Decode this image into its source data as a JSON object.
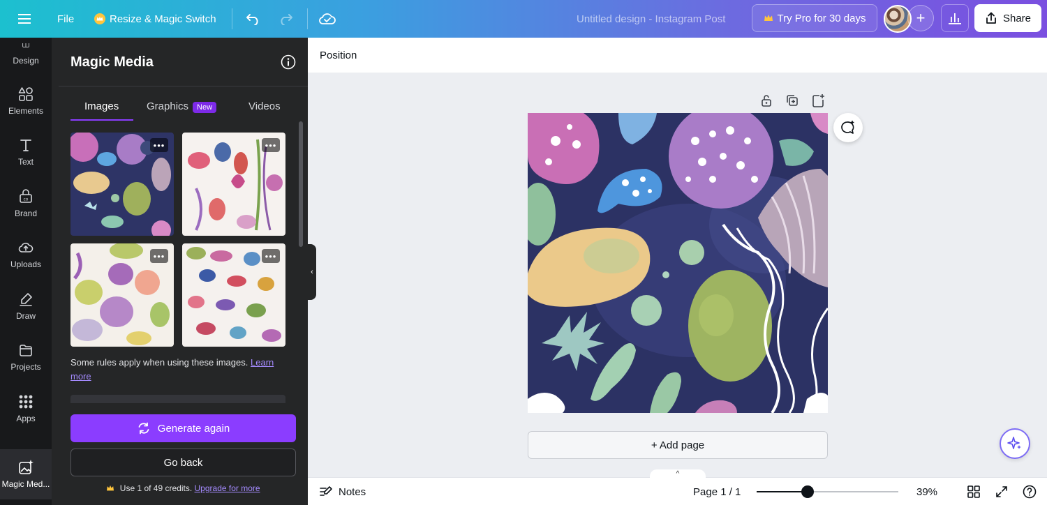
{
  "topbar": {
    "file_label": "File",
    "resize_label": "Resize & Magic Switch",
    "design_title": "Untitled design - Instagram Post",
    "try_pro_label": "Try Pro for 30 days",
    "share_label": "Share",
    "icons": [
      "menu-icon",
      "crown-icon",
      "undo-icon",
      "redo-icon",
      "cloud-saved-icon",
      "stats-icon",
      "share-icon"
    ]
  },
  "rail": {
    "items": [
      {
        "label": "Design",
        "icon": "design-icon"
      },
      {
        "label": "Elements",
        "icon": "elements-icon"
      },
      {
        "label": "Text",
        "icon": "text-icon"
      },
      {
        "label": "Brand",
        "icon": "brand-icon"
      },
      {
        "label": "Uploads",
        "icon": "uploads-icon"
      },
      {
        "label": "Draw",
        "icon": "draw-icon"
      },
      {
        "label": "Projects",
        "icon": "projects-icon"
      },
      {
        "label": "Apps",
        "icon": "apps-icon"
      },
      {
        "label": "Magic Med...",
        "icon": "magic-media-icon"
      }
    ]
  },
  "panel": {
    "title": "Magic Media",
    "tabs": [
      {
        "label": "Images"
      },
      {
        "label": "Graphics",
        "badge": "New"
      },
      {
        "label": "Videos"
      }
    ],
    "rules_text": "Some rules apply when using these images.",
    "rules_link": "Learn more",
    "generate_again_label": "Generate again",
    "go_back_label": "Go back",
    "credits_text": "Use 1 of 49 credits.",
    "credits_link": "Upgrade for more",
    "more_label": "•••"
  },
  "canvas": {
    "context_label": "Position",
    "add_page_label": "+ Add page"
  },
  "bottombar": {
    "notes_label": "Notes",
    "page_indicator": "Page 1 / 1",
    "zoom_label": "39%",
    "zoom_fraction": 0.36
  },
  "colors": {
    "accent": "#8b3dff",
    "panel_bg": "#252627",
    "rail_bg": "#18191b",
    "canvas_bg": "#eceef2"
  }
}
